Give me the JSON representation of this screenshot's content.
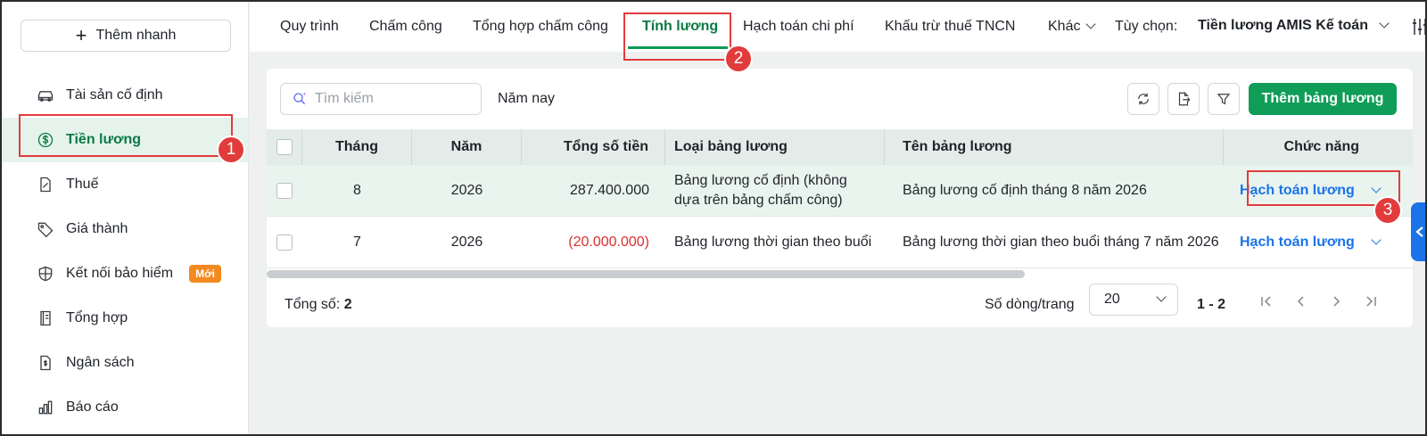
{
  "sidebar": {
    "quick_add": "Thêm nhanh",
    "items": [
      {
        "label": "Tài sản cố định",
        "icon": "car-icon"
      },
      {
        "label": "Tiền lương",
        "icon": "dollar-circle-icon",
        "active": true
      },
      {
        "label": "Thuế",
        "icon": "tax-document-icon"
      },
      {
        "label": "Giá thành",
        "icon": "price-tag-icon"
      },
      {
        "label": "Kết nối bảo hiểm",
        "icon": "shield-icon",
        "badge": "Mới"
      },
      {
        "label": "Tổng hợp",
        "icon": "ledger-book-icon"
      },
      {
        "label": "Ngân sách",
        "icon": "budget-document-icon"
      },
      {
        "label": "Báo cáo",
        "icon": "bar-chart-icon"
      }
    ]
  },
  "tabs": [
    {
      "label": "Quy trình"
    },
    {
      "label": "Chấm công"
    },
    {
      "label": "Tổng hợp chấm công"
    },
    {
      "label": "Tính lương",
      "active": true
    },
    {
      "label": "Hạch toán chi phí"
    },
    {
      "label": "Khấu trừ thuế TNCN"
    },
    {
      "label": "Khác"
    }
  ],
  "options": {
    "label": "Tùy chọn:",
    "value": "Tiền lương AMIS Kế toán"
  },
  "toolbar": {
    "search_placeholder": "Tìm kiếm",
    "period": "Năm nay",
    "add_button": "Thêm bảng lương"
  },
  "table": {
    "headers": {
      "month": "Tháng",
      "year": "Năm",
      "total": "Tổng số tiền",
      "type": "Loại bảng lương",
      "name": "Tên bảng lương",
      "func": "Chức năng"
    },
    "rows": [
      {
        "month": "8",
        "year": "2026",
        "total": "287.400.000",
        "type": "Bảng lương cố định (không dựa trên bảng chấm công)",
        "name": "Bảng lương cố định tháng 8 năm 2026",
        "func": "Hạch toán lương"
      },
      {
        "month": "7",
        "year": "2026",
        "total": "(20.000.000)",
        "type": "Bảng lương thời gian theo buổi",
        "name": "Bảng lương thời gian theo buổi tháng 7 năm 2026",
        "func": "Hạch toán lương"
      }
    ]
  },
  "footer": {
    "total_label": "Tổng số:",
    "total_value": "2",
    "rows_per_page_label": "Số dòng/trang",
    "rows_per_page_value": "20",
    "page_range": "1 - 2"
  },
  "annotations": [
    "1",
    "2",
    "3"
  ],
  "colors": {
    "accent": "#0f9d58",
    "link": "#1a73e8",
    "negative": "#d9302f",
    "highlight": "#e23b3b"
  }
}
